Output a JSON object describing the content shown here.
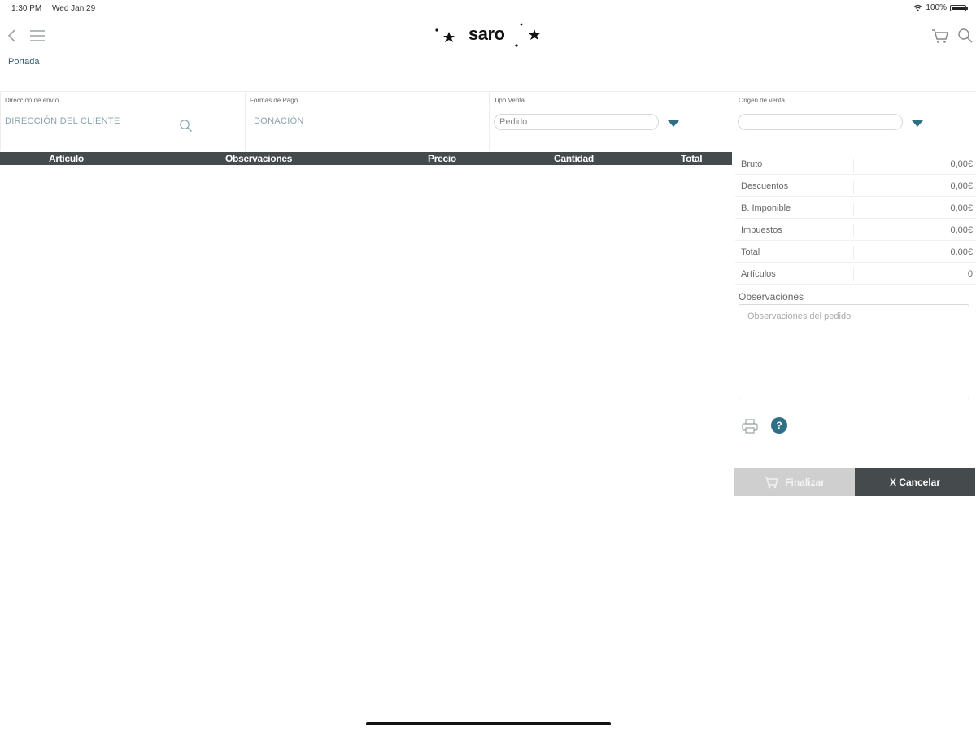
{
  "status_bar": {
    "time": "1:30 PM",
    "date": "Wed Jan 29",
    "battery": "100%"
  },
  "nav": {
    "logo_text": "saro",
    "icons": [
      "chevron-left-icon",
      "menu-icon",
      "cart-icon",
      "search-icon"
    ]
  },
  "breadcrumb": "Portada",
  "form": {
    "direccion": {
      "label": "Dirección de envío",
      "value": "DIRECCIÓN DEL CLIENTE"
    },
    "formas_pago": {
      "label": "Formas de Pago",
      "value": "DONACIÓN"
    },
    "tipo_venta": {
      "label": "Tipo Venta",
      "value": "Pedido"
    },
    "origen_venta": {
      "label": "Origen de venta",
      "value": ""
    }
  },
  "table": {
    "columns": [
      "Artículo",
      "Observaciones",
      "Precio",
      "Cantidad",
      "Total"
    ],
    "rows": []
  },
  "summary": [
    {
      "label": "Bruto",
      "value": "0,00€"
    },
    {
      "label": "Descuentos",
      "value": "0,00€"
    },
    {
      "label": "B. Imponible",
      "value": "0,00€"
    },
    {
      "label": "Impuestos",
      "value": "0,00€"
    },
    {
      "label": "Total",
      "value": "0,00€"
    },
    {
      "label": "Artículos",
      "value": "0"
    }
  ],
  "observaciones": {
    "label": "Observaciones",
    "placeholder": "Observaciones del pedido"
  },
  "actions": {
    "help_glyph": "?",
    "finalizar_label": "Finalizar",
    "cancelar_label": "X Cancelar"
  },
  "colors": {
    "accent": "#2f6f86",
    "header_dark": "#454a4c",
    "disabled_button": "#cfcfcf"
  }
}
